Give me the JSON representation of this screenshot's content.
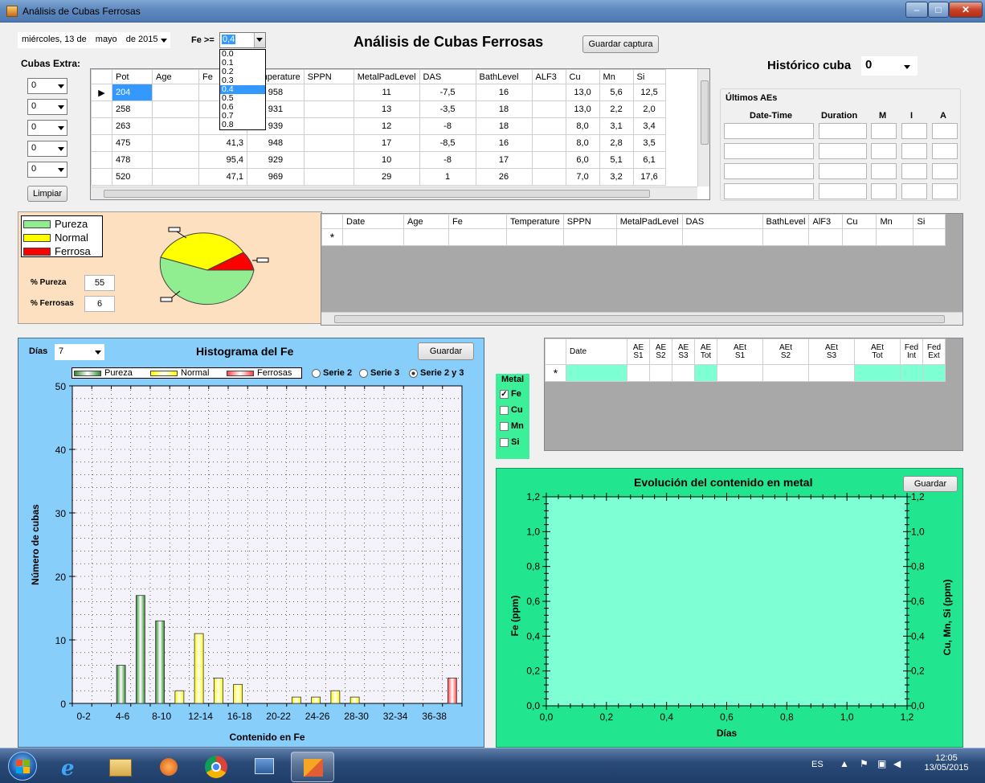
{
  "window": {
    "title": "Análisis de Cubas Ferrosas"
  },
  "header": {
    "date": {
      "weekday_day": "miércoles, 13 de",
      "month": "mayo",
      "year": "de 2015"
    },
    "fe_label": "Fe >=",
    "fe_value": "0,4",
    "fe_options": [
      "0.0",
      "0.1",
      "0.2",
      "0.3",
      "0.4",
      "0.5",
      "0.6",
      "0.7",
      "0.8"
    ],
    "fe_selected": "0.4",
    "app_title": "Análisis de Cubas Ferrosas",
    "save_capture": "Guardar captura",
    "historico_label": "Histórico cuba",
    "historico_value": "0"
  },
  "cubas_extra": {
    "label": "Cubas Extra:",
    "combos": [
      "0",
      "0",
      "0",
      "0",
      "0"
    ],
    "clear_button": "Limpiar"
  },
  "main_grid": {
    "columns": [
      "Pot",
      "Age",
      "Fe",
      "Temperature",
      "SPPN",
      "MetalPadLevel",
      "DAS",
      "BathLevel",
      "ALF3",
      "Cu",
      "Mn",
      "Si"
    ],
    "rows": [
      [
        "204",
        "",
        "7",
        "958",
        "",
        "11",
        "-7,5",
        "16",
        "",
        "13,0",
        "5,6",
        "12,5"
      ],
      [
        "258",
        "",
        "5",
        "931",
        "",
        "13",
        "-3,5",
        "18",
        "",
        "13,0",
        "2,2",
        "2,0"
      ],
      [
        "263",
        "",
        "5",
        "939",
        "",
        "12",
        "-8",
        "18",
        "",
        "8,0",
        "3,1",
        "3,4"
      ],
      [
        "475",
        "",
        "41,3",
        "948",
        "",
        "17",
        "-8,5",
        "16",
        "",
        "8,0",
        "2,8",
        "3,5"
      ],
      [
        "478",
        "",
        "95,4",
        "929",
        "",
        "10",
        "-8",
        "17",
        "",
        "6,0",
        "5,1",
        "6,1"
      ],
      [
        "520",
        "",
        "47,1",
        "969",
        "",
        "29",
        "1",
        "26",
        "",
        "7,0",
        "3,2",
        "17,6"
      ]
    ]
  },
  "ultimos_aes": {
    "label": "Últimos AEs",
    "columns": [
      "Date-Time",
      "Duration",
      "M",
      "I",
      "A"
    ]
  },
  "pie_panel": {
    "legend": [
      "Pureza",
      "Normal",
      "Ferrosa"
    ],
    "colors": {
      "pureza": "#90ee90",
      "normal": "#ffff00",
      "ferrosa": "#ff0000"
    },
    "pureza_label": "% Pureza",
    "pureza_value": "55",
    "ferrosas_label": "% Ferrosas",
    "ferrosas_value": "6"
  },
  "history_grid": {
    "columns": [
      "Date",
      "Age",
      "Fe",
      "Temperature",
      "SPPN",
      "MetalPadLevel",
      "DAS",
      "BathLevel",
      "AlF3",
      "Cu",
      "Mn",
      "Si"
    ],
    "new_row_marker": "*"
  },
  "histogram": {
    "dias_label": "Días",
    "dias_value": "7",
    "title": "Histograma del Fe",
    "save_button": "Guardar",
    "series_options": [
      "Serie 2",
      "Serie 3",
      "Serie 2 y 3"
    ],
    "series_selected": "Serie 2 y 3",
    "xlabel": "Contenido en Fe",
    "ylabel": "Número de cubas"
  },
  "metal_group": {
    "label": "Metal",
    "options": [
      {
        "label": "Fe",
        "checked": true
      },
      {
        "label": "Cu",
        "checked": false
      },
      {
        "label": "Mn",
        "checked": false
      },
      {
        "label": "Si",
        "checked": false
      }
    ]
  },
  "ae_grid": {
    "columns": [
      [
        "Date"
      ],
      [
        "AE",
        "S1"
      ],
      [
        "AE",
        "S2"
      ],
      [
        "AE",
        "S3"
      ],
      [
        "AE",
        "Tot"
      ],
      [
        "AEt",
        "S1"
      ],
      [
        "AEt",
        "S2"
      ],
      [
        "AEt",
        "S3"
      ],
      [
        "AEt",
        "Tot"
      ],
      [
        "Fed",
        "Int"
      ],
      [
        "Fed",
        "Ext"
      ]
    ],
    "new_row_marker": "*"
  },
  "evolution": {
    "title": "Evolución del contenido en metal",
    "save_button": "Guardar",
    "xlabel": "Días",
    "ylabel_left": "Fe (ppm)",
    "ylabel_right": "Cu, Mn, Si (ppm)"
  },
  "chart_data": [
    {
      "type": "bar",
      "title": "Histograma del Fe",
      "xlabel": "Contenido en Fe",
      "ylabel": "Número de cubas",
      "ylim": [
        0,
        50
      ],
      "yticks": [
        0,
        10,
        20,
        30,
        40,
        50
      ],
      "xtick_labels": [
        "0-2",
        "4-6",
        "8-10",
        "12-14",
        "16-18",
        "20-22",
        "24-26",
        "28-30",
        "32-34",
        "36-38"
      ],
      "categories": [
        "0-2",
        "2-4",
        "4-6",
        "6-8",
        "8-10",
        "10-12",
        "12-14",
        "14-16",
        "16-18",
        "18-20",
        "20-22",
        "22-24",
        "24-26",
        "26-28",
        "28-30",
        "30-32",
        "32-34",
        "34-36",
        "36-38",
        "38+"
      ],
      "series": [
        {
          "name": "Pureza",
          "color": "#2e8b2e",
          "values": [
            0,
            0,
            6,
            17,
            13,
            0,
            0,
            0,
            0,
            0,
            0,
            0,
            0,
            0,
            0,
            0,
            0,
            0,
            0,
            0
          ]
        },
        {
          "name": "Normal",
          "color": "#ffff00",
          "values": [
            0,
            0,
            0,
            0,
            0,
            2,
            11,
            4,
            3,
            0,
            0,
            1,
            1,
            2,
            1,
            0,
            0,
            0,
            0,
            0
          ]
        },
        {
          "name": "Ferrosas",
          "color": "#ff4040",
          "values": [
            0,
            0,
            0,
            0,
            0,
            0,
            0,
            0,
            0,
            0,
            0,
            0,
            0,
            0,
            0,
            0,
            0,
            0,
            0,
            4
          ]
        }
      ],
      "grid": true,
      "legend": "top"
    },
    {
      "type": "line",
      "title": "Evolución del contenido en metal",
      "xlabel": "Días",
      "ylabel": "Fe (ppm)",
      "ylabel_right": "Cu, Mn, Si (ppm)",
      "xlim": [
        0.0,
        1.2
      ],
      "ylim": [
        0.0,
        1.2
      ],
      "xticks": [
        "0,0",
        "0,2",
        "0,4",
        "0,6",
        "0,8",
        "1,0",
        "1,2"
      ],
      "yticks": [
        "0,0",
        "0,2",
        "0,4",
        "0,6",
        "0,8",
        "1,0",
        "1,2"
      ],
      "series": []
    }
  ],
  "taskbar": {
    "lang": "ES",
    "time": "12:05",
    "date": "13/05/2015"
  }
}
